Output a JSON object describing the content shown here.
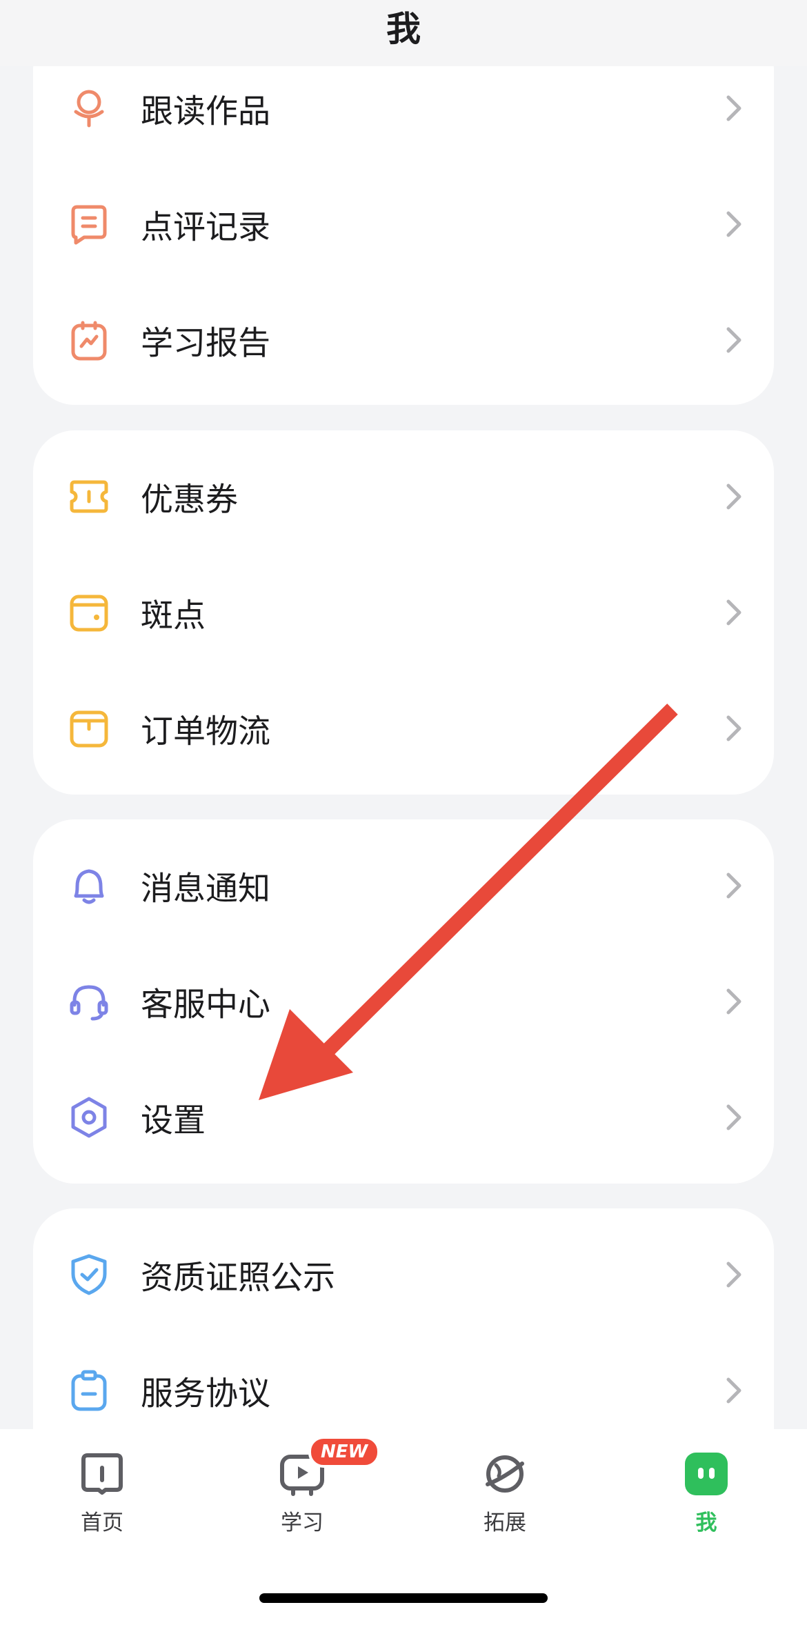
{
  "header": {
    "title": "我"
  },
  "groups": [
    {
      "items": [
        {
          "label": "跟读作品",
          "icon": "microphone-icon"
        },
        {
          "label": "点评记录",
          "icon": "comment-icon"
        },
        {
          "label": "学习报告",
          "icon": "report-icon"
        }
      ]
    },
    {
      "items": [
        {
          "label": "优惠券",
          "icon": "coupon-icon"
        },
        {
          "label": "斑点",
          "icon": "wallet-icon"
        },
        {
          "label": "订单物流",
          "icon": "package-icon"
        }
      ]
    },
    {
      "items": [
        {
          "label": "消息通知",
          "icon": "bell-icon"
        },
        {
          "label": "客服中心",
          "icon": "headset-icon"
        },
        {
          "label": "设置",
          "icon": "settings-icon"
        }
      ]
    },
    {
      "items": [
        {
          "label": "资质证照公示",
          "icon": "shield-icon"
        },
        {
          "label": "服务协议",
          "icon": "clipboard-icon"
        }
      ]
    }
  ],
  "tabbar": {
    "tabs": [
      {
        "label": "首页",
        "icon": "book-icon"
      },
      {
        "label": "学习",
        "icon": "play-tv-icon",
        "badge": "NEW"
      },
      {
        "label": "拓展",
        "icon": "planet-icon"
      },
      {
        "label": "我",
        "icon": "profile-face-icon",
        "active": true
      }
    ]
  },
  "colors": {
    "orange": "#ef8a6a",
    "yellow": "#f5b73b",
    "purple": "#7d83e6",
    "blue": "#5aa7ee",
    "active_green": "#2fbf5c",
    "badge_red": "#f04b3a",
    "arrow_red": "#e8493a"
  }
}
